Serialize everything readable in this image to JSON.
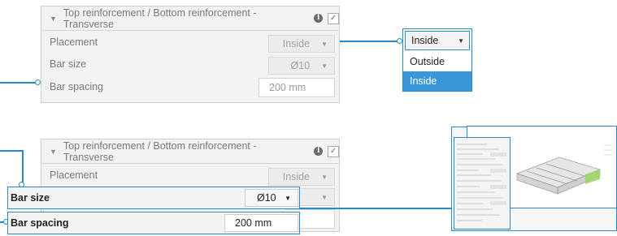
{
  "colors": {
    "accent": "#2a8bc4",
    "selected_bg": "#3a96d6"
  },
  "panel": {
    "title": "Top reinforcement / Bottom reinforcement - Transverse",
    "collapse_icon": "triangle-down-icon",
    "info_icon": "info-icon",
    "check_icon": "checkmark-icon",
    "rows": {
      "placement_label": "Placement",
      "placement_value": "Inside",
      "bar_size_label": "Bar size",
      "bar_size_value": "Ø10",
      "bar_spacing_label": "Bar spacing",
      "bar_spacing_value": "200 mm"
    }
  },
  "popup": {
    "current": "Inside",
    "options": [
      "Outside",
      "Inside"
    ],
    "selected_option": "Inside"
  },
  "zoom": {
    "bar_size_label": "Bar size",
    "bar_size_value": "Ø10",
    "bar_size_behind": "0",
    "bar_spacing_label": "Bar spacing",
    "bar_spacing_value": "200 mm"
  }
}
